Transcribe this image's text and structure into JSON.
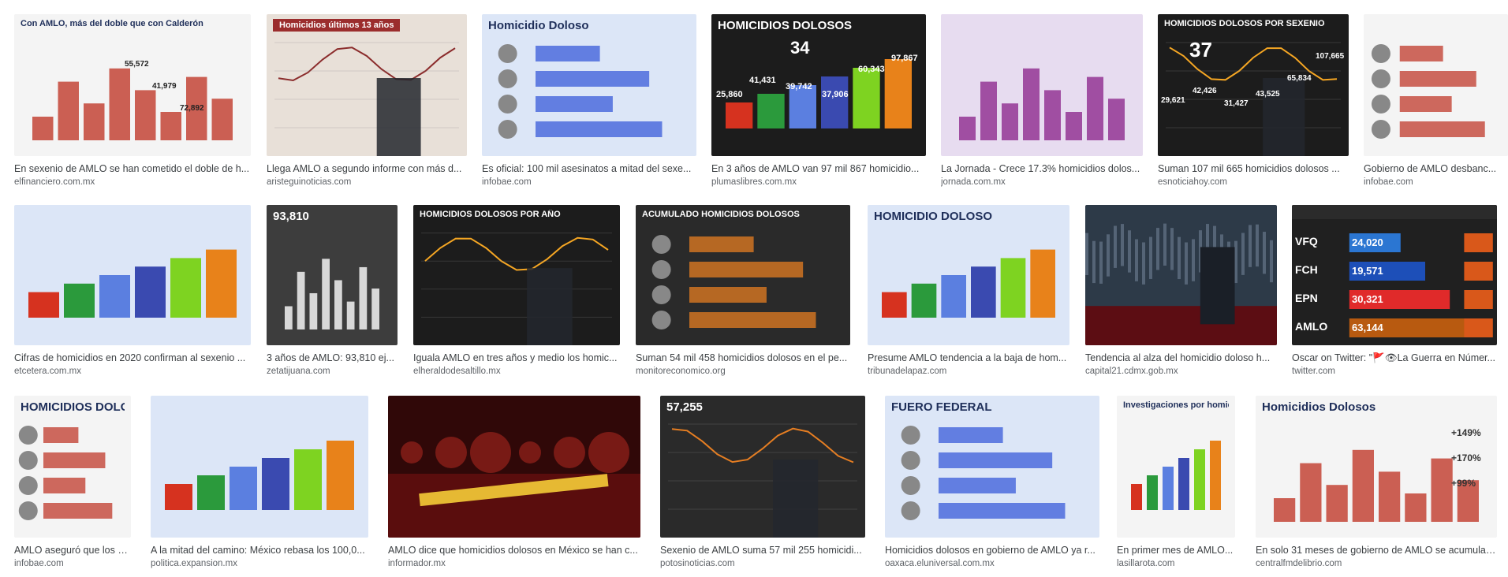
{
  "results": [
    {
      "title": "En sexenio de AMLO se han cometido el doble de h...",
      "source": "elfinanciero.com.mx",
      "overlay": "Con AMLO, más del doble que con Calderón",
      "theme": "white"
    },
    {
      "title": "Llega AMLO a segundo informe con más d...",
      "source": "aristeguinoticias.com",
      "overlay": "Homicidios últimos 13 años",
      "theme": "red"
    },
    {
      "title": "Es oficial: 100 mil asesinatos a mitad del sexe...",
      "source": "infobae.com",
      "overlay": "Homicidio Doloso",
      "theme": "blue"
    },
    {
      "title": "En 3 años de AMLO van 97 mil 867 homicidio...",
      "source": "plumaslibres.com.mx",
      "overlay": "HOMICIDIOS DOLOSOS",
      "theme": "dark"
    },
    {
      "title": "La Jornada - Crece 17.3% homicidios dolos...",
      "source": "jornada.com.mx",
      "overlay": "",
      "theme": "purple"
    },
    {
      "title": "Suman 107 mil 665 homicidios dolosos ...",
      "source": "esnoticiahoy.com",
      "overlay": "HOMICIDIOS DOLOSOS POR SEXENIO",
      "theme": "dark"
    },
    {
      "title": "Gobierno de AMLO desbanc...",
      "source": "infobae.com",
      "overlay": "",
      "theme": "white"
    },
    {
      "title": "Cifras de homicidios en 2020 confirman al sexenio ...",
      "source": "etcetera.com.mx",
      "overlay": "",
      "theme": "blue"
    },
    {
      "title": "3 años de AMLO: 93,810 ej...",
      "source": "zetatijuana.com",
      "overlay": "93,810",
      "theme": "gray"
    },
    {
      "title": "Iguala AMLO en tres años y medio los homic...",
      "source": "elheraldodesaltillo.mx",
      "overlay": "HOMICIDIOS DOLOSOS POR AÑO",
      "theme": "dark"
    },
    {
      "title": "Suman 54 mil 458 homicidios dolosos en el pe...",
      "source": "monitoreconomico.org",
      "overlay": "ACUMULADO HOMICIDIOS DOLOSOS",
      "theme": "darkorange"
    },
    {
      "title": "Presume AMLO tendencia a la baja de hom...",
      "source": "tribunadelapaz.com",
      "overlay": "HOMICIDIO DOLOSO",
      "theme": "blue"
    },
    {
      "title": "Tendencia al alza del homicidio doloso h...",
      "source": "capital21.cdmx.gob.mx",
      "overlay": "",
      "theme": "stage"
    },
    {
      "title": "Oscar on Twitter: \"🚩👁La Guerra en Númer...",
      "source": "twitter.com",
      "overlay": "",
      "theme": "darkbar"
    },
    {
      "title": "AMLO aseguró que los h...",
      "source": "infobae.com",
      "overlay": "HOMICIDIOS DOLOSOS",
      "theme": "white"
    },
    {
      "title": "A la mitad del camino: México rebasa los 100,0...",
      "source": "politica.expansion.mx",
      "overlay": "",
      "theme": "blue"
    },
    {
      "title": "AMLO dice que homicidios dolosos en México se han c...",
      "source": "informador.mx",
      "overlay": "",
      "theme": "night"
    },
    {
      "title": "Sexenio de AMLO suma 57 mil 255 homicidi...",
      "source": "potosinoticias.com",
      "overlay": "57,255",
      "theme": "darkorange"
    },
    {
      "title": "Homicidios dolosos en gobierno de AMLO ya r...",
      "source": "oaxaca.eluniversal.com.mx",
      "overlay": "FUERO FEDERAL",
      "theme": "blue"
    },
    {
      "title": "En primer mes de AMLO...",
      "source": "lasillarota.com",
      "overlay": "Investigaciones por homicidio",
      "theme": "white"
    },
    {
      "title": "En solo 31 meses de gobierno de AMLO se acumulan...",
      "source": "centralfmdelibrio.com",
      "overlay": "Homicidios Dolosos",
      "theme": "white"
    }
  ],
  "thumb_labels": {
    "r1c1_values": [
      "55,572",
      "41,979",
      "72,892"
    ],
    "r1c4_months": "34",
    "r1c4_values": [
      "25,860",
      "41,431",
      "39,742",
      "37,906",
      "60,343",
      "97,867"
    ],
    "r1c6_months": "37",
    "r1c6_values": [
      "29,621",
      "42,426",
      "31,427",
      "43,525",
      "65,834",
      "107,665"
    ],
    "r2c6_labels": [
      "VFQ",
      "FCH",
      "EPN",
      "AMLO"
    ],
    "r2c6_values": [
      "24,020",
      "19,571",
      "30,321",
      "63,144"
    ],
    "r3c7_pcts": [
      "+149%",
      "+170%",
      "+99%"
    ]
  }
}
